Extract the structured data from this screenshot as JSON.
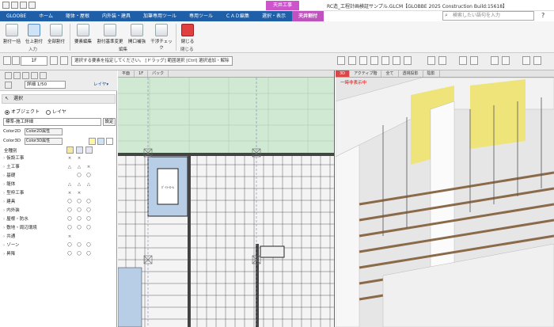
{
  "window": {
    "title": "RC造_工程計画検証サンプル.GLCM【GLOBBE 2025 Construction Build:15618】",
    "context_tab": "天井工事"
  },
  "search": {
    "placeholder": "検索したい語句を入力"
  },
  "ribbon_tabs": [
    {
      "label": "GLOOBE",
      "active": false,
      "color": "#1f5fa8"
    },
    {
      "label": "ホーム",
      "active": false,
      "color": "#1f5fa8"
    },
    {
      "label": "躯体・屋根",
      "active": false,
      "color": "#1f5fa8"
    },
    {
      "label": "内外装・建具",
      "active": false,
      "color": "#1f5fa8"
    },
    {
      "label": "加筆専用ツール",
      "active": false,
      "color": "#1f5fa8"
    },
    {
      "label": "専用ツール",
      "active": false,
      "color": "#1f5fa8"
    },
    {
      "label": "ＣＡＤ編集",
      "active": false,
      "color": "#1f5fa8"
    },
    {
      "label": "選択・表示",
      "active": false,
      "color": "#1f5fa8"
    },
    {
      "label": "天井割付",
      "active": true,
      "color": "#c052c0"
    }
  ],
  "ribbon": {
    "buttons": [
      "割付一括",
      "仕上割付",
      "全部割付",
      "要素編集",
      "割付基準変更",
      "開口補強",
      "干渉チェック",
      "閉じる"
    ],
    "groups": [
      "入力",
      "編集",
      "閉じる"
    ]
  },
  "toolbar": {
    "floor": "1F",
    "hint": "選択する要素を指定してください。 [ドラッグ] 範囲選択  [Ctrl] 選択追加・解除"
  },
  "palette": {
    "scale": "詳細 1/50",
    "layer_button": "レイヤ▾",
    "select_header": "選択",
    "radio_object": "オブジェクト",
    "radio_layer": "レイヤ",
    "standard": "標準-施工詳細",
    "settings": "設定",
    "color2d_label": "Color2D",
    "color2d_value": "Color2D属性",
    "color3d_label": "Color3D",
    "color3d_value": "Color3D属性",
    "list_header": "全種別",
    "rows": [
      {
        "label": "仮設工事",
        "marks": [
          "×",
          "×",
          ""
        ]
      },
      {
        "label": "土工事",
        "marks": [
          "△",
          "△",
          "×"
        ]
      },
      {
        "label": "基礎",
        "marks": [
          "",
          "〇",
          "〇"
        ]
      },
      {
        "label": "躯体",
        "marks": [
          "△",
          "△",
          "△"
        ]
      },
      {
        "label": "型枠工事",
        "marks": [
          "×",
          "×",
          ""
        ]
      },
      {
        "label": "建具",
        "marks": [
          "〇",
          "〇",
          "〇"
        ]
      },
      {
        "label": "内外装",
        "marks": [
          "〇",
          "〇",
          "〇"
        ]
      },
      {
        "label": "屋根・防水",
        "marks": [
          "〇",
          "〇",
          "〇"
        ]
      },
      {
        "label": "敷地・周辺環境",
        "marks": [
          "〇",
          "〇",
          "〇"
        ]
      },
      {
        "label": "共通",
        "marks": [
          "×",
          "",
          ""
        ]
      },
      {
        "label": "ゾーン",
        "marks": [
          "〇",
          "〇",
          "〇"
        ]
      },
      {
        "label": "昇降",
        "marks": [
          "〇",
          "〇",
          "〇"
        ]
      }
    ]
  },
  "plan_view": {
    "tabs": [
      "平面",
      "1F",
      "パック"
    ],
    "room_label": "ﾎﾞｲﾗｰﾛｰﾑ"
  },
  "view3d": {
    "tabs": [
      "3D",
      "アクティブ階",
      "全て",
      "透視投影",
      "陰影"
    ],
    "note": "一時非表示中"
  },
  "colors": {
    "ribbon_tab_bg": "#1f5fa8",
    "active_tab": "#c052c0",
    "plan_green": "#cfe9d2",
    "plan_blue": "#b8cde6",
    "yellow_insulation": "#efe47a"
  }
}
